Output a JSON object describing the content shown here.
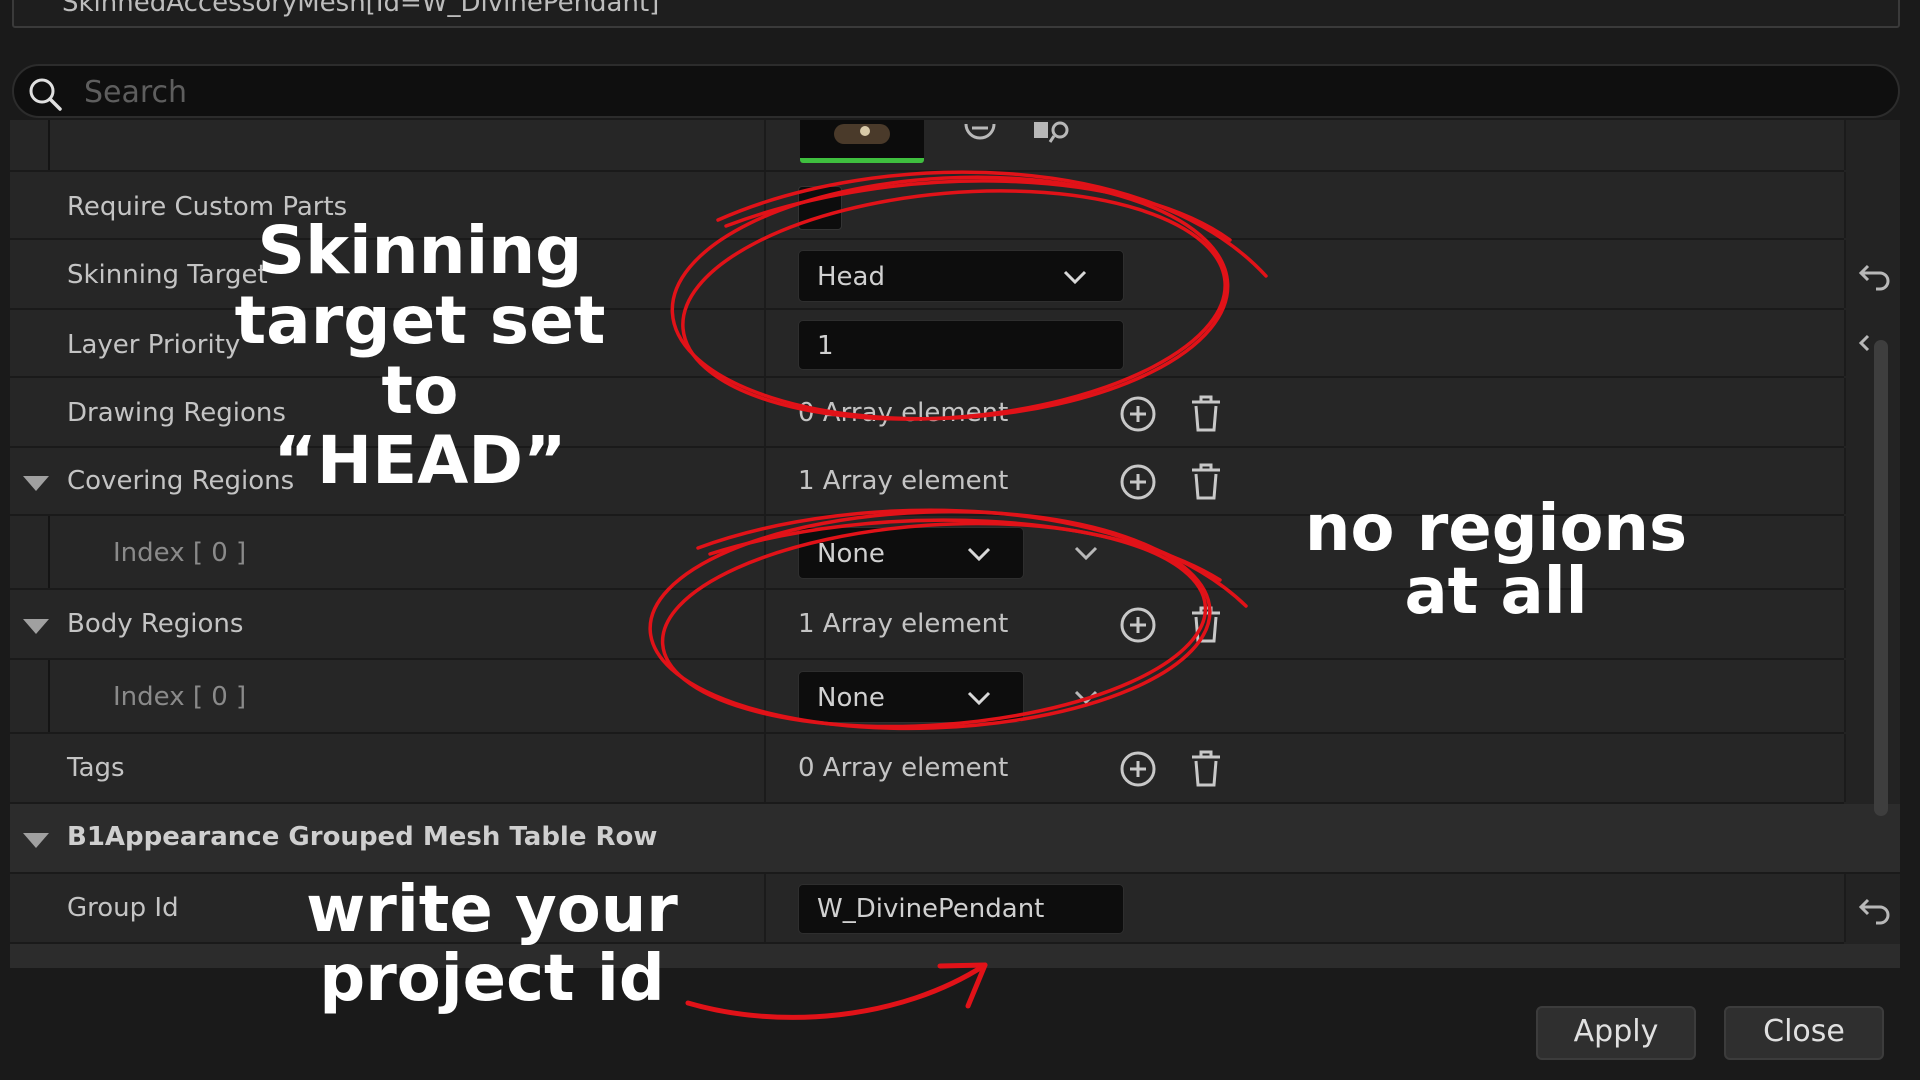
{
  "window": {
    "title": "SkinnedAccessoryMesh[Id=W_DivinePendant]"
  },
  "search": {
    "placeholder": "Search",
    "value": ""
  },
  "rows": {
    "require_custom_parts": {
      "label": "Require Custom Parts"
    },
    "skinning_target": {
      "label": "Skinning Target",
      "value": "Head"
    },
    "layer_priority": {
      "label": "Layer Priority",
      "value": "1"
    },
    "drawing_regions": {
      "label": "Drawing Regions",
      "value": "0 Array element"
    },
    "covering_regions": {
      "label": "Covering Regions",
      "value": "1 Array element"
    },
    "covering_index": {
      "label": "Index [ 0 ]",
      "value": "None"
    },
    "body_regions": {
      "label": "Body Regions",
      "value": "1 Array element"
    },
    "body_index": {
      "label": "Index [ 0 ]",
      "value": "None"
    },
    "tags": {
      "label": "Tags",
      "value": "0 Array element"
    }
  },
  "group": {
    "header": "B1Appearance Grouped Mesh Table Row",
    "group_id": {
      "label": "Group Id",
      "value": "W_DivinePendant"
    }
  },
  "buttons": {
    "apply": "Apply",
    "close": "Close"
  },
  "annotations": {
    "skinning_line1": "Skinning",
    "skinning_line2": "target set to",
    "skinning_line3": "“HEAD”",
    "regions_line1": "no regions",
    "regions_line2": "at all",
    "project_line1": "write your",
    "project_line2": "project id"
  },
  "colors": {
    "annotation_red": "#e11218",
    "background": "#1a1a1a",
    "row": "#262626"
  },
  "icons": [
    "search-icon",
    "browse-icon",
    "use-selected-icon",
    "add-element-icon",
    "delete-element-icon",
    "dropdown-chevron-icon",
    "reset-to-default-icon",
    "collapse-arrow-icon"
  ]
}
